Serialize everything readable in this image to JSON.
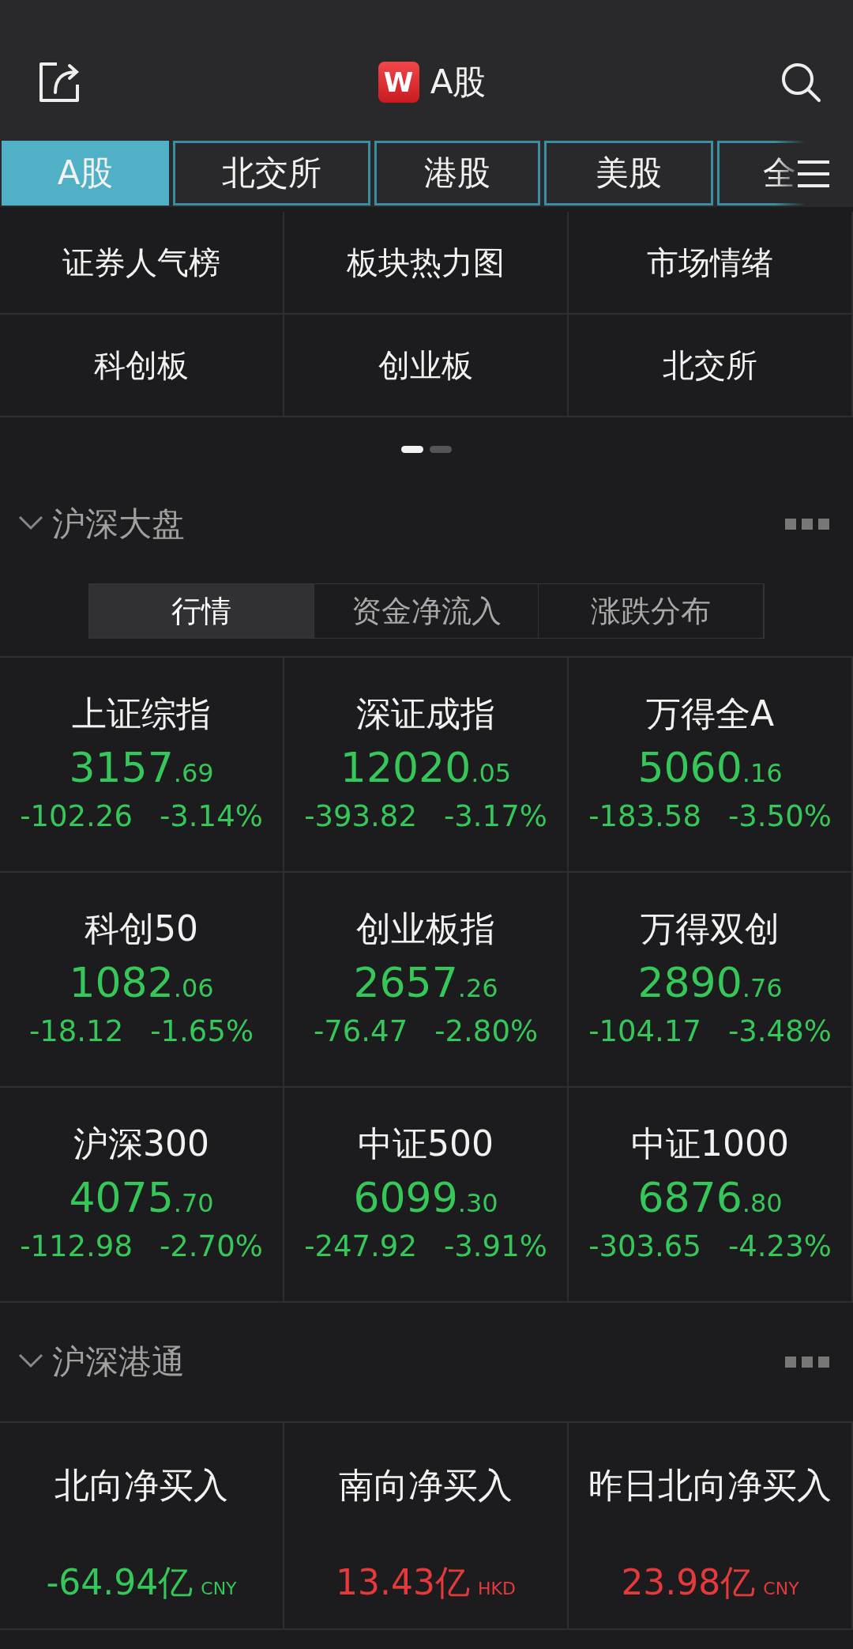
{
  "header": {
    "title": "A股",
    "logo": "W"
  },
  "market_tabs": [
    {
      "label": "A股",
      "selected": true
    },
    {
      "label": "北交所",
      "selected": false
    },
    {
      "label": "港股",
      "selected": false
    },
    {
      "label": "美股",
      "selected": false
    },
    {
      "label": "全",
      "selected": false
    }
  ],
  "quick_links": [
    "证券人气榜",
    "板块热力图",
    "市场情绪",
    "科创板",
    "创业板",
    "北交所"
  ],
  "pager": [
    {
      "selected": true
    },
    {
      "selected": false
    }
  ],
  "sections": [
    {
      "title": "沪深大盘",
      "expanded": true,
      "segments": [
        {
          "label": "行情",
          "selected": true
        },
        {
          "label": "资金净流入",
          "selected": false
        },
        {
          "label": "涨跌分布",
          "selected": false
        }
      ],
      "indices": [
        {
          "name": "上证综指",
          "value_int": "3157",
          "value_dec": ".69",
          "change": "-102.26",
          "percent": "-3.14%",
          "color": "#35c759"
        },
        {
          "name": "深证成指",
          "value_int": "12020",
          "value_dec": ".05",
          "change": "-393.82",
          "percent": "-3.17%",
          "color": "#35c759"
        },
        {
          "name": "万得全A",
          "value_int": "5060",
          "value_dec": ".16",
          "change": "-183.58",
          "percent": "-3.50%",
          "color": "#35c759"
        },
        {
          "name": "科创50",
          "value_int": "1082",
          "value_dec": ".06",
          "change": "-18.12",
          "percent": "-1.65%",
          "color": "#35c759"
        },
        {
          "name": "创业板指",
          "value_int": "2657",
          "value_dec": ".26",
          "change": "-76.47",
          "percent": "-2.80%",
          "color": "#35c759"
        },
        {
          "name": "万得双创",
          "value_int": "2890",
          "value_dec": ".76",
          "change": "-104.17",
          "percent": "-3.48%",
          "color": "#35c759"
        },
        {
          "name": "沪深300",
          "value_int": "4075",
          "value_dec": ".70",
          "change": "-112.98",
          "percent": "-2.70%",
          "color": "#35c759"
        },
        {
          "name": "中证500",
          "value_int": "6099",
          "value_dec": ".30",
          "change": "-247.92",
          "percent": "-3.91%",
          "color": "#35c759"
        },
        {
          "name": "中证1000",
          "value_int": "6876",
          "value_dec": ".80",
          "change": "-303.65",
          "percent": "-4.23%",
          "color": "#35c759"
        }
      ]
    },
    {
      "title": "沪深港通",
      "expanded": true,
      "flows": [
        {
          "name": "北向净买入",
          "amount": "-64.94亿",
          "currency": "CNY",
          "color": "#35c759"
        },
        {
          "name": "南向净买入",
          "amount": "13.43亿",
          "currency": "HKD",
          "color": "#e5393c"
        },
        {
          "name": "昨日北向净买入",
          "amount": "23.98亿",
          "currency": "CNY",
          "color": "#e5393c"
        }
      ]
    }
  ]
}
